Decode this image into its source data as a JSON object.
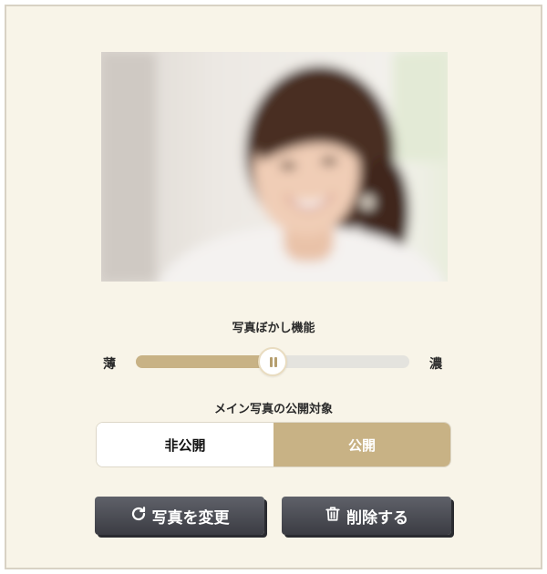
{
  "photo": {
    "alt_icon": "blurred-portrait-photo"
  },
  "blur": {
    "label": "写真ぼかし機能",
    "min_label": "薄",
    "max_label": "濃",
    "level": 0.5
  },
  "visibility": {
    "label": "メイン写真の公開対象",
    "options": [
      "非公開",
      "公開"
    ],
    "selected": "公開"
  },
  "buttons": {
    "change_label": "写真を変更",
    "delete_label": "削除する"
  },
  "colors": {
    "accent": "#c8b285",
    "panel_bg": "#f8f4e8",
    "button_dark": "#45464d"
  }
}
